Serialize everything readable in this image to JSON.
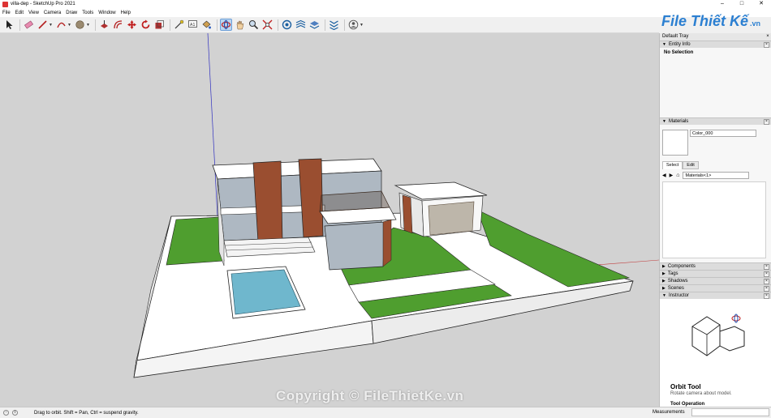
{
  "window": {
    "title": "villa-dep - SketchUp Pro 2021",
    "minimize": "–",
    "maximize": "□",
    "close": "✕"
  },
  "menu": [
    "File",
    "Edit",
    "View",
    "Camera",
    "Draw",
    "Tools",
    "Window",
    "Help"
  ],
  "toolbar": [
    {
      "name": "select-tool-icon"
    },
    {
      "name": "eraser-tool-icon"
    },
    {
      "name": "line-tool-icon"
    },
    {
      "name": "arc-tool-icon"
    },
    {
      "name": "shape-tool-icon"
    },
    {
      "name": "push-pull-tool-icon"
    },
    {
      "name": "offset-tool-icon"
    },
    {
      "name": "move-tool-icon"
    },
    {
      "name": "rotate-tool-icon"
    },
    {
      "name": "scale-tool-icon"
    },
    {
      "name": "tape-measure-tool-icon"
    },
    {
      "name": "text-tool-icon"
    },
    {
      "name": "paint-bucket-tool-icon"
    },
    {
      "name": "orbit-tool-icon",
      "active": true
    },
    {
      "name": "pan-tool-icon"
    },
    {
      "name": "zoom-tool-icon"
    },
    {
      "name": "zoom-extents-tool-icon"
    },
    {
      "name": "3d-warehouse-icon"
    },
    {
      "name": "extension-warehouse-icon"
    },
    {
      "name": "layout-icon"
    },
    {
      "name": "extension-manager-icon"
    },
    {
      "name": "user-account-icon"
    }
  ],
  "logo": {
    "text": "File Thiết Kế",
    "suffix": ".vn"
  },
  "watermark": "Copyright © FileThietKe.vn",
  "tray": {
    "title": "Default Tray",
    "entity_info": {
      "label": "Entity Info",
      "content": "No Selection"
    },
    "materials": {
      "label": "Materials",
      "name_value": "Color_000",
      "tabs": [
        "Select",
        "Edit"
      ],
      "selected_tab": "Select",
      "collection": "Materials<1>"
    },
    "collapsed": [
      "Components",
      "Tags",
      "Shadows",
      "Scenes"
    ],
    "instructor": {
      "label": "Instructor",
      "tool_title": "Orbit Tool",
      "tool_desc": "Rotate camera about model.",
      "operation_heading": "Tool Operation"
    }
  },
  "status": {
    "hint": "Drag to orbit. Shift = Pan, Ctrl = suspend gravity.",
    "measurements_label": "Measurements",
    "measurements_value": ""
  },
  "colors": {
    "background": "#d2d2d2",
    "lawn": "#4f9e2f",
    "pool": "#6fb7cd",
    "brick": "#9a4e30",
    "platform": "#ffffff",
    "accent": "#2b7fd1"
  }
}
